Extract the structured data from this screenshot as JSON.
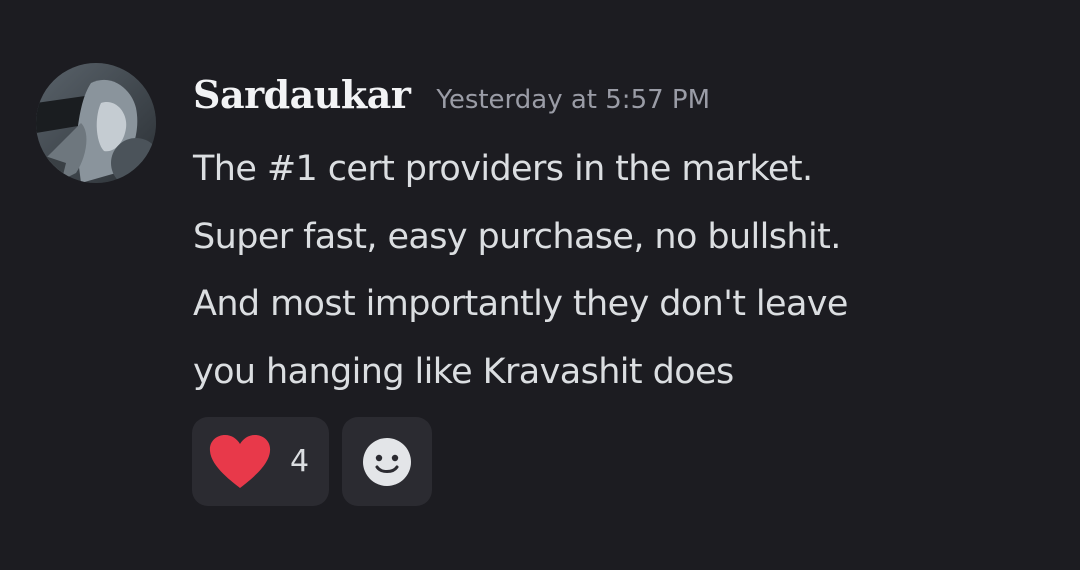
{
  "message": {
    "author": "Sardaukar",
    "timestamp": "Yesterday at 5:57 PM",
    "lines": [
      "The #1 cert providers in the market.",
      "Super fast, easy purchase, no bullshit.",
      "And most importantly they don't leave",
      "you hanging like Kravashit does"
    ]
  },
  "reactions": [
    {
      "icon": "heart-icon",
      "count": "4",
      "color": "#e8394a"
    },
    {
      "icon": "add-reaction-smiley-icon"
    }
  ],
  "colors": {
    "background": "#1c1c21",
    "username": "#f2f3f5",
    "timestamp": "#9a9ca6",
    "text": "#dbdee1",
    "reaction_bg": "#2b2b31"
  }
}
